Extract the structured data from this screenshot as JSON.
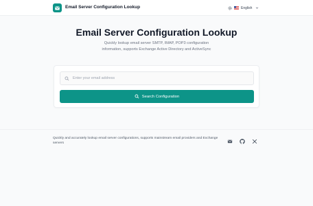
{
  "header": {
    "app_title": "Email Server Configuration Lookup",
    "logo_icon": "mail-icon",
    "language": {
      "icon": "gear-icon",
      "flag": "us-flag-icon",
      "label": "English",
      "dropdown_icon": "chevron-down-icon"
    }
  },
  "main": {
    "title": "Email Server Configuration Lookup",
    "subtitle": "Quickly lookup email server SMTP, IMAP, POP3 configuration information, supports Exchange Active Directory and ActiveSync",
    "search": {
      "placeholder": "Enter your email address",
      "value": "",
      "button_label": "Search Configuration"
    }
  },
  "footer": {
    "text": "Quickly and accurately lookup email server configurations, supports mainstream email providers and Exchange servers",
    "icons": [
      "mail-icon",
      "github-icon",
      "x-icon"
    ]
  },
  "colors": {
    "accent": "#0d9488",
    "background": "#f9fafb"
  }
}
